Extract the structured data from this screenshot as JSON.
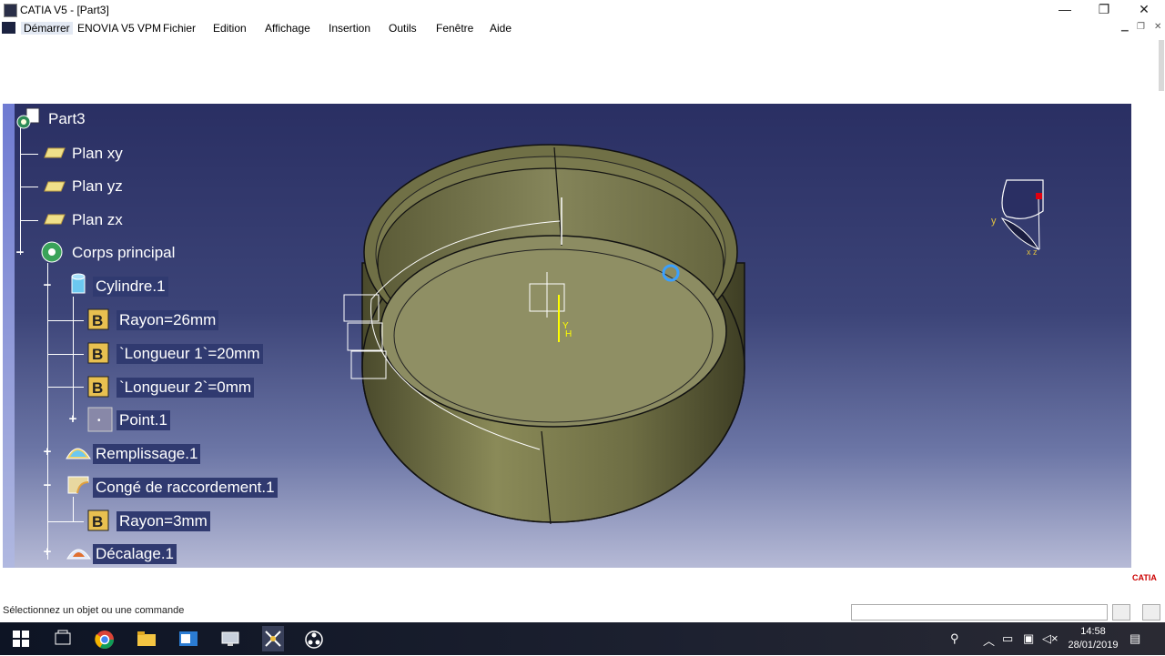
{
  "window": {
    "title": "CATIA V5 - [Part3]",
    "min": "—",
    "max": "❐",
    "close": "✕"
  },
  "menu": {
    "items": [
      "Démarrer",
      "ENOVIA V5 VPM",
      "Fichier",
      "Edition",
      "Affichage",
      "Insertion",
      "Outils",
      "Fenêtre",
      "Aide"
    ]
  },
  "tree": {
    "root": "Part3",
    "plan_xy": "Plan xy",
    "plan_yz": "Plan yz",
    "plan_zx": "Plan zx",
    "corps": "Corps principal",
    "cylindre": "Cylindre.1",
    "rayon": "Rayon=26mm",
    "longueur1": "`Longueur 1`=20mm",
    "longueur2": "`Longueur 2`=0mm",
    "point": "Point.1",
    "remplissage": "Remplissage.1",
    "conge": "Congé de raccordement.1",
    "rayon2": "Rayon=3mm",
    "decalage": "Décalage.1"
  },
  "compass": {
    "y": "y",
    "xz": "x z"
  },
  "model": {
    "axis_y": "Y",
    "axis_h": "H"
  },
  "status": {
    "message": "Sélectionnez un objet ou une commande",
    "logo": "CATIA"
  },
  "taskbar": {
    "time": "14:58",
    "date": "28/01/2019"
  },
  "colors": {
    "viewport_top": "#2a2f63",
    "viewport_bottom": "#b6bad6",
    "part": "#7a7a4a"
  }
}
